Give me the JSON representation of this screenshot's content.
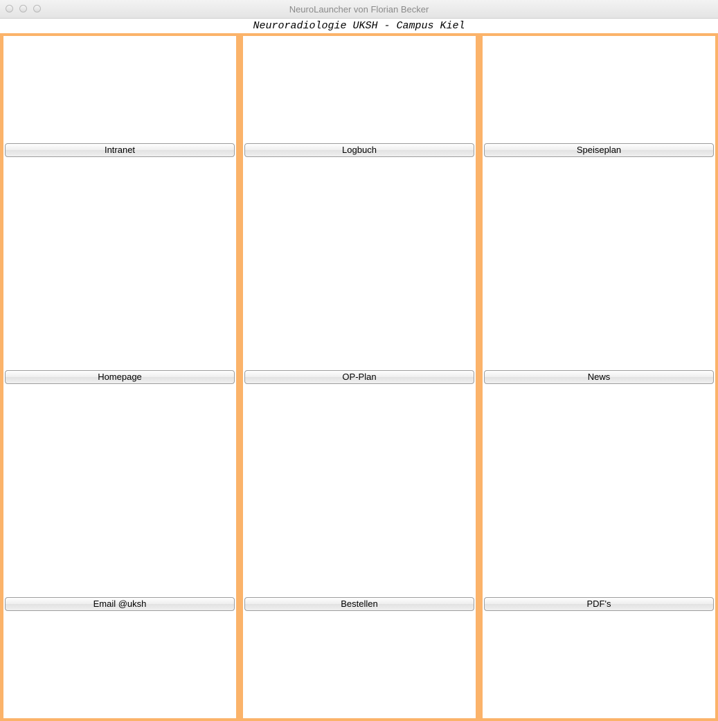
{
  "window": {
    "title": "NeuroLauncher von Florian Becker"
  },
  "header": {
    "label": "Neuroradiologie UKSH - Campus Kiel"
  },
  "colors": {
    "frame": "#fbb36a",
    "panel": "#ffffff"
  },
  "buttons": {
    "intranet": "Intranet",
    "logbuch": "Logbuch",
    "speiseplan": "Speiseplan",
    "homepage": "Homepage",
    "op_plan": "OP-Plan",
    "news": "News",
    "email": "Email @uksh",
    "bestellen": "Bestellen",
    "pdfs": "PDF's"
  }
}
